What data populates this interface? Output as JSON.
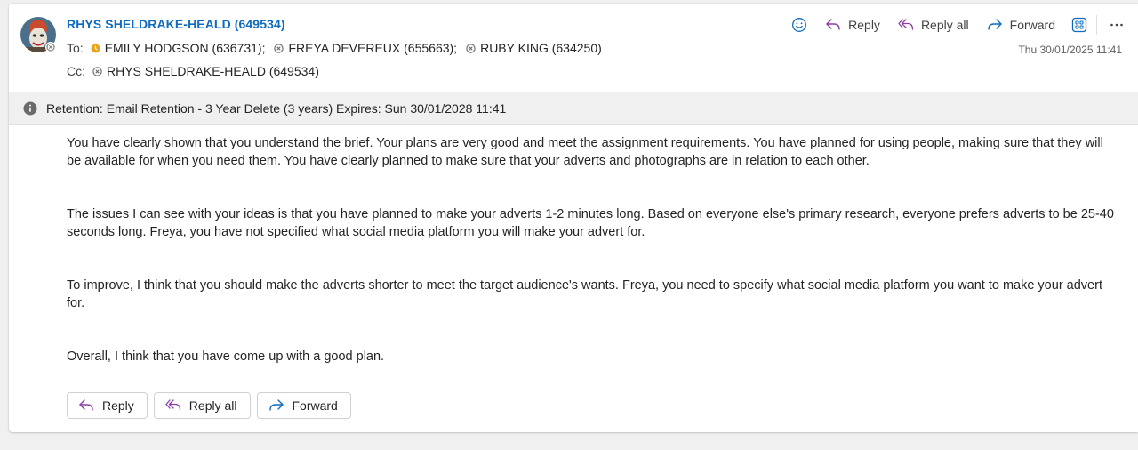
{
  "message": {
    "sender": "RHYS SHELDRAKE-HEALD (649534)",
    "to_label": "To:",
    "cc_label": "Cc:",
    "to": [
      {
        "name": "EMILY HODGSON (636731);",
        "status": "away"
      },
      {
        "name": "FREYA DEVEREUX (655663);",
        "status": "offline"
      },
      {
        "name": "RUBY KING (634250)",
        "status": "offline"
      }
    ],
    "cc": [
      {
        "name": "RHYS SHELDRAKE-HEALD (649534)",
        "status": "offline"
      }
    ],
    "timestamp": "Thu 30/01/2025 11:41"
  },
  "toolbar": {
    "emoji_icon": "smile-icon",
    "reply_label": "Reply",
    "reply_all_label": "Reply all",
    "forward_label": "Forward",
    "apps_icon": "apps-icon",
    "more_icon": "more-icon"
  },
  "retention": {
    "text": "Retention: Email Retention - 3 Year Delete (3 years) Expires: Sun 30/01/2028 11:41",
    "icon": "info-icon"
  },
  "body": {
    "paragraphs": [
      "You have clearly shown that you understand the brief. Your plans are very good and meet the assignment requirements. You have planned for using people, making sure that they will be available for when you need them. You have clearly planned to make sure that your adverts and photographs are in relation to each other.",
      "The issues I can see with your ideas is that you have planned to make your adverts 1-2 minutes long. Based on everyone else's primary research, everyone prefers adverts to be 25-40 seconds long. Freya, you have not specified what social media platform you will make your advert for.",
      "To improve, I think that you should make the adverts shorter to meet the target audience's wants. Freya, you need to specify what social media platform you want to make your advert for.",
      "Overall, I think that you have come up with a good plan."
    ]
  },
  "actions": {
    "reply_label": "Reply",
    "reply_all_label": "Reply all",
    "forward_label": "Forward"
  },
  "colors": {
    "accent": "#0f6cbd",
    "reply_icon": "#8b3fa6",
    "forward_icon": "#0f6cbd",
    "away_status": "#e8a317"
  }
}
